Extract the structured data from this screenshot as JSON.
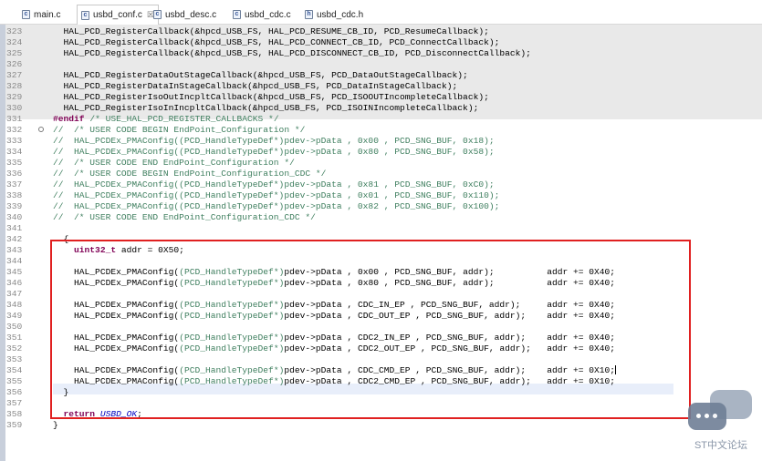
{
  "tabs": [
    {
      "label": "main.c",
      "icon": "c-file-icon",
      "active": false
    },
    {
      "label": "usbd_conf.c",
      "icon": "c-file-icon",
      "active": true,
      "close": "☒"
    },
    {
      "label": "usbd_desc.c",
      "icon": "c-file-icon",
      "active": false
    },
    {
      "label": "usbd_cdc.c",
      "icon": "c-file-icon",
      "active": false
    },
    {
      "label": "usbd_cdc.h",
      "icon": "h-file-icon",
      "active": false
    }
  ],
  "editor": {
    "current_line": 354,
    "highlight_box_color": "#e02020",
    "lines": [
      {
        "n": "323",
        "t": "  HAL_PCD_RegisterCallback(&hpcd_USB_FS, HAL_PCD_RESUME_CB_ID, PCD_ResumeCallback);"
      },
      {
        "n": "324",
        "t": "  HAL_PCD_RegisterCallback(&hpcd_USB_FS, HAL_PCD_CONNECT_CB_ID, PCD_ConnectCallback);"
      },
      {
        "n": "325",
        "t": "  HAL_PCD_RegisterCallback(&hpcd_USB_FS, HAL_PCD_DISCONNECT_CB_ID, PCD_DisconnectCallback);"
      },
      {
        "n": "326",
        "t": ""
      },
      {
        "n": "327",
        "t": "  HAL_PCD_RegisterDataOutStageCallback(&hpcd_USB_FS, PCD_DataOutStageCallback);"
      },
      {
        "n": "328",
        "t": "  HAL_PCD_RegisterDataInStageCallback(&hpcd_USB_FS, PCD_DataInStageCallback);"
      },
      {
        "n": "329",
        "t": "  HAL_PCD_RegisterIsoOutIncpltCallback(&hpcd_USB_FS, PCD_ISOOUTIncompleteCallback);"
      },
      {
        "n": "330",
        "t": "  HAL_PCD_RegisterIsoInIncpltCallback(&hpcd_USB_FS, PCD_ISOINIncompleteCallback);"
      },
      {
        "n": "331",
        "t": "#endif /* USE_HAL_PCD_REGISTER_CALLBACKS */"
      },
      {
        "n": "332",
        "t": "//  /* USER CODE BEGIN EndPoint_Configuration */",
        "fold": true
      },
      {
        "n": "333",
        "t": "//  HAL_PCDEx_PMAConfig((PCD_HandleTypeDef*)pdev->pData , 0x00 , PCD_SNG_BUF, 0x18);"
      },
      {
        "n": "334",
        "t": "//  HAL_PCDEx_PMAConfig((PCD_HandleTypeDef*)pdev->pData , 0x80 , PCD_SNG_BUF, 0x58);"
      },
      {
        "n": "335",
        "t": "//  /* USER CODE END EndPoint_Configuration */"
      },
      {
        "n": "336",
        "t": "//  /* USER CODE BEGIN EndPoint_Configuration_CDC */"
      },
      {
        "n": "337",
        "t": "//  HAL_PCDEx_PMAConfig((PCD_HandleTypeDef*)pdev->pData , 0x81 , PCD_SNG_BUF, 0xC0);"
      },
      {
        "n": "338",
        "t": "//  HAL_PCDEx_PMAConfig((PCD_HandleTypeDef*)pdev->pData , 0x01 , PCD_SNG_BUF, 0x110);"
      },
      {
        "n": "339",
        "t": "//  HAL_PCDEx_PMAConfig((PCD_HandleTypeDef*)pdev->pData , 0x82 , PCD_SNG_BUF, 0x100);"
      },
      {
        "n": "340",
        "t": "//  /* USER CODE END EndPoint_Configuration_CDC */"
      },
      {
        "n": "341",
        "t": ""
      },
      {
        "n": "342",
        "t": "  {"
      },
      {
        "n": "343",
        "t": "    uint32_t addr = 0X50;"
      },
      {
        "n": "344",
        "t": ""
      },
      {
        "n": "345",
        "t": "    HAL_PCDEx_PMAConfig((PCD_HandleTypeDef*)pdev->pData , 0x00 , PCD_SNG_BUF, addr);          addr += 0X40;"
      },
      {
        "n": "346",
        "t": "    HAL_PCDEx_PMAConfig((PCD_HandleTypeDef*)pdev->pData , 0x80 , PCD_SNG_BUF, addr);          addr += 0X40;"
      },
      {
        "n": "347",
        "t": ""
      },
      {
        "n": "348",
        "t": "    HAL_PCDEx_PMAConfig((PCD_HandleTypeDef*)pdev->pData , CDC_IN_EP , PCD_SNG_BUF, addr);     addr += 0X40;"
      },
      {
        "n": "349",
        "t": "    HAL_PCDEx_PMAConfig((PCD_HandleTypeDef*)pdev->pData , CDC_OUT_EP , PCD_SNG_BUF, addr);    addr += 0X40;"
      },
      {
        "n": "350",
        "t": ""
      },
      {
        "n": "351",
        "t": "    HAL_PCDEx_PMAConfig((PCD_HandleTypeDef*)pdev->pData , CDC2_IN_EP , PCD_SNG_BUF, addr);    addr += 0X40;"
      },
      {
        "n": "352",
        "t": "    HAL_PCDEx_PMAConfig((PCD_HandleTypeDef*)pdev->pData , CDC2_OUT_EP , PCD_SNG_BUF, addr);   addr += 0X40;"
      },
      {
        "n": "353",
        "t": ""
      },
      {
        "n": "354",
        "t": "    HAL_PCDEx_PMAConfig((PCD_HandleTypeDef*)pdev->pData , CDC_CMD_EP , PCD_SNG_BUF, addr);    addr += 0X10;"
      },
      {
        "n": "355",
        "t": "    HAL_PCDEx_PMAConfig((PCD_HandleTypeDef*)pdev->pData , CDC2_CMD_EP , PCD_SNG_BUF, addr);   addr += 0X10;"
      },
      {
        "n": "356",
        "t": "  }"
      },
      {
        "n": "357",
        "t": ""
      },
      {
        "n": "358",
        "t": "  return USBD_OK;"
      },
      {
        "n": "359",
        "t": "}"
      }
    ]
  },
  "watermark": {
    "text": "ST中文论坛",
    "icon": "chat-bubbles-icon"
  }
}
